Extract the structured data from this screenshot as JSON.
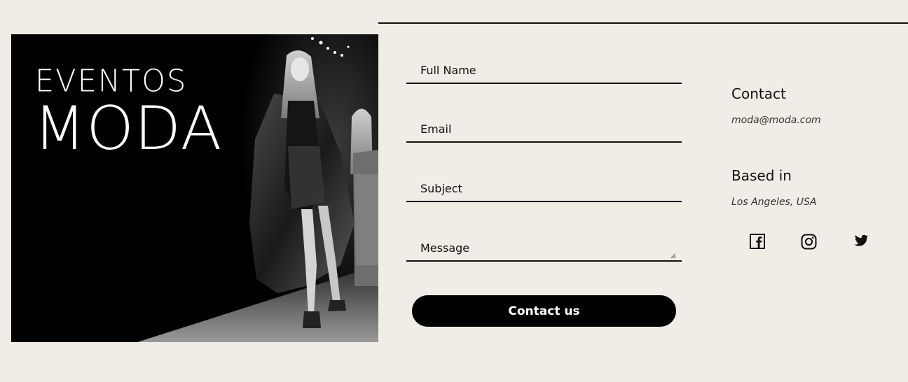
{
  "hero": {
    "title_small": "EVENTOS",
    "title_big": "MODA",
    "image": "runway-models-photo"
  },
  "form": {
    "fields": [
      {
        "label": "Full Name",
        "value": ""
      },
      {
        "label": "Email",
        "value": ""
      },
      {
        "label": "Subject",
        "value": ""
      },
      {
        "label": "Message",
        "value": ""
      }
    ],
    "submit_label": "Contact us"
  },
  "info": {
    "contact_heading": "Contact",
    "email": "moda@moda.com",
    "based_heading": "Based in",
    "location": "Los Angeles, USA"
  },
  "social": [
    {
      "icon": "facebook-icon"
    },
    {
      "icon": "instagram-icon"
    },
    {
      "icon": "twitter-icon"
    }
  ],
  "colors": {
    "background": "#f1ece6",
    "accent": "#000000",
    "button_text": "#ffffff"
  }
}
